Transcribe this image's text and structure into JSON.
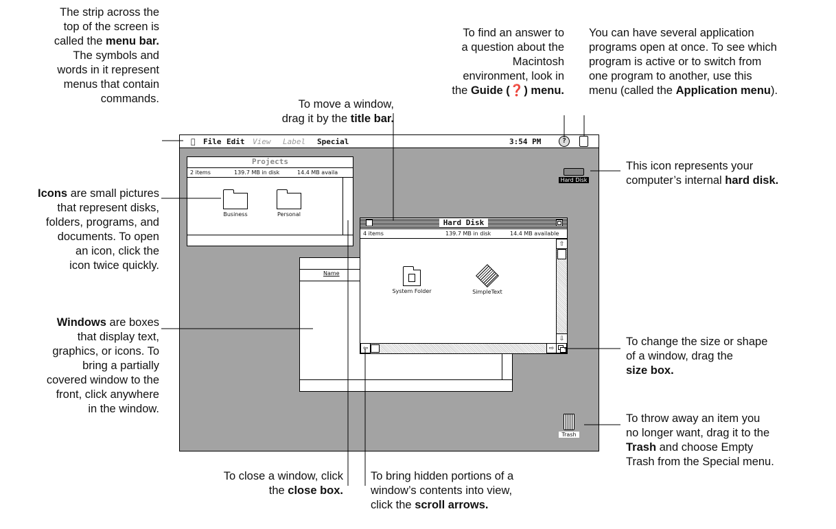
{
  "captions": {
    "menu_bar": {
      "l1": "The strip across the",
      "l2": "top of the screen is",
      "l3a": "called the ",
      "l3b": "menu bar.",
      "l4": "The symbols and",
      "l5": "words in it represent",
      "l6": "menus that contain",
      "l7": "commands."
    },
    "icons": {
      "l1a": "Icons",
      "l1b": " are small pictures",
      "l2": "that represent disks,",
      "l3": "folders, programs, and",
      "l4": "documents. To open",
      "l5": "an icon, click the",
      "l6": "icon twice quickly."
    },
    "windows": {
      "l1a": "Windows",
      "l1b": " are boxes",
      "l2": "that display text,",
      "l3": "graphics, or icons. To",
      "l4": "bring a partially",
      "l5": "covered window to the",
      "l6": "front, click anywhere",
      "l7": "in the window."
    },
    "title_bar": {
      "l1": "To move a window,",
      "l2a": "drag it by the ",
      "l2b": "title bar."
    },
    "guide": {
      "l1": "To find an answer to",
      "l2": "a question about the",
      "l3": "Macintosh",
      "l4": "environment, look in",
      "l5a": "the ",
      "l5b": "Guide (❓) menu."
    },
    "app_menu": {
      "l1": "You can have several application",
      "l2": "programs open at once. To see which",
      "l3": "program is active or to switch from",
      "l4": "one program to another, use this",
      "l5a": "menu (called the ",
      "l5b": "Application menu",
      "l5c": ")."
    },
    "hard_disk": {
      "l1": "This icon represents your",
      "l2a": "computer’s internal ",
      "l2b": "hard disk."
    },
    "size_box": {
      "l1": "To change the size or shape",
      "l2": "of a window, drag the",
      "l3": "size box."
    },
    "trash": {
      "l1": "To throw away an item you",
      "l2": "no longer want, drag it to the",
      "l3a": "Trash",
      "l3b": " and choose Empty",
      "l4": "Trash from the Special menu."
    },
    "close_box": {
      "l1": "To close a window, click",
      "l2a": "the ",
      "l2b": "close box."
    },
    "scroll": {
      "l1": "To bring hidden portions of a",
      "l2": "window’s contents into view,",
      "l3a": "click the ",
      "l3b": "scroll arrows."
    }
  },
  "menubar": {
    "apple": "",
    "file": "File",
    "edit": "Edit",
    "view": "View",
    "label": "Label",
    "special": "Special",
    "time": "3:54 PM"
  },
  "projects_window": {
    "title": "Projects",
    "items": "2 items",
    "disk": "139.7 MB in disk",
    "avail": "14.4 MB availa",
    "icon1": "Business",
    "icon2": "Personal"
  },
  "hard_disk_window": {
    "title": "Hard Disk",
    "items": "4 items",
    "disk": "139.7 MB in disk",
    "avail": "14.4 MB available",
    "icon1": "System Folder",
    "icon2": "SimpleText"
  },
  "back_window": {
    "col": "Name"
  },
  "desktop": {
    "hard_disk": "Hard Disk",
    "trash": "Trash"
  },
  "colors": {
    "desktop": "#a3a3a3"
  }
}
